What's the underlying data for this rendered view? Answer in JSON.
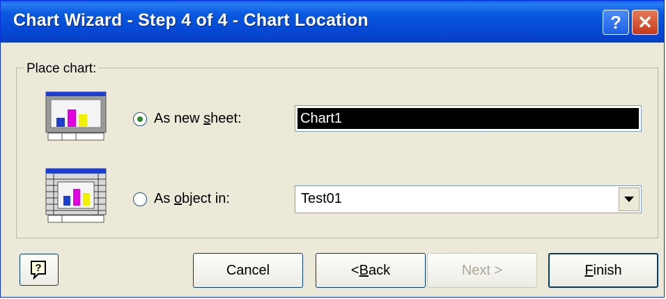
{
  "window": {
    "title": "Chart Wizard - Step 4 of 4 - Chart Location",
    "help_glyph": "?",
    "close_glyph": "✕"
  },
  "group": {
    "label": "Place chart:"
  },
  "options": {
    "new_sheet": {
      "label_pre": "As new ",
      "label_key": "s",
      "label_post": "heet:",
      "checked": true,
      "value": "Chart1"
    },
    "object_in": {
      "label_pre": "As ",
      "label_key": "o",
      "label_post": "bject in:",
      "checked": false,
      "value": "Test01"
    }
  },
  "buttons": {
    "help_glyph": "?",
    "cancel": "Cancel",
    "back_pre": "< ",
    "back_key": "B",
    "back_post": "ack",
    "next": "Next >",
    "finish_key": "F",
    "finish_post": "inish"
  },
  "colors": {
    "title_bar": "#0548d4",
    "dialog_bg": "#ece9d8",
    "chart_bar_blue": "#1c3fd0",
    "chart_bar_magenta": "#e000e0",
    "chart_bar_yellow": "#f0f000"
  }
}
